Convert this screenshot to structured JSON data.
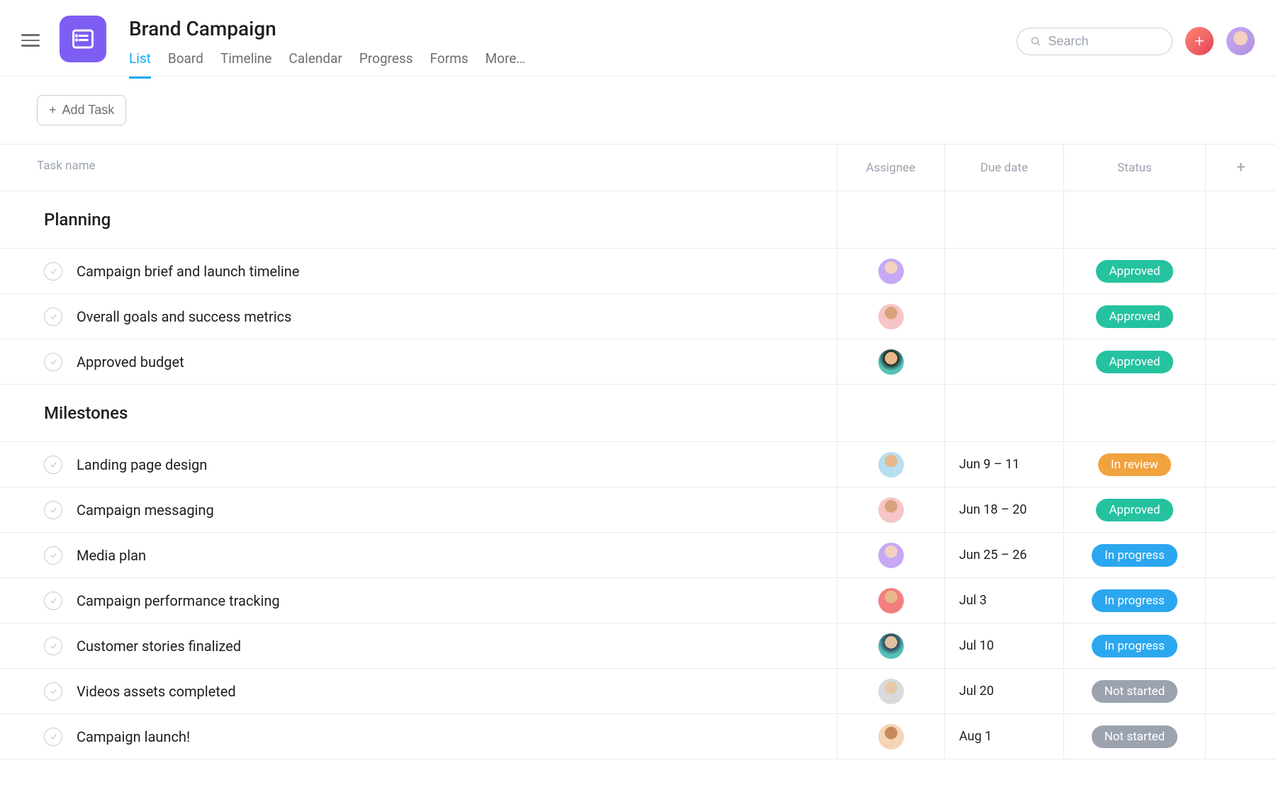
{
  "header": {
    "project_title": "Brand Campaign",
    "tabs": [
      "List",
      "Board",
      "Timeline",
      "Calendar",
      "Progress",
      "Forms",
      "More…"
    ],
    "active_tab_index": 0,
    "search_placeholder": "Search"
  },
  "toolbar": {
    "add_task_label": "Add Task"
  },
  "columns": {
    "task": "Task name",
    "assignee": "Assignee",
    "due": "Due date",
    "status": "Status"
  },
  "status_styles": {
    "Approved": "st-approved",
    "In review": "st-inreview",
    "In progress": "st-inprogress",
    "Not started": "st-notstarted"
  },
  "sections": [
    {
      "title": "Planning",
      "tasks": [
        {
          "name": "Campaign brief and launch timeline",
          "assignee": "av-purple",
          "due": "",
          "status": "Approved"
        },
        {
          "name": "Overall goals and success metrics",
          "assignee": "av-pink",
          "due": "",
          "status": "Approved"
        },
        {
          "name": "Approved budget",
          "assignee": "av-teal",
          "due": "",
          "status": "Approved"
        }
      ]
    },
    {
      "title": "Milestones",
      "tasks": [
        {
          "name": "Landing page design",
          "assignee": "av-blue",
          "due": "Jun 9 – 11",
          "status": "In review"
        },
        {
          "name": "Campaign messaging",
          "assignee": "av-pink",
          "due": "Jun 18 – 20",
          "status": "Approved"
        },
        {
          "name": "Media plan",
          "assignee": "av-purple",
          "due": "Jun 25 – 26",
          "status": "In progress"
        },
        {
          "name": "Campaign performance tracking",
          "assignee": "av-coral",
          "due": "Jul 3",
          "status": "In progress"
        },
        {
          "name": "Customer stories finalized",
          "assignee": "av-navy",
          "due": "Jul 10",
          "status": "In progress"
        },
        {
          "name": "Videos assets completed",
          "assignee": "av-grey",
          "due": "Jul 20",
          "status": "Not started"
        },
        {
          "name": "Campaign launch!",
          "assignee": "av-peach",
          "due": "Aug 1",
          "status": "Not started"
        }
      ]
    }
  ]
}
